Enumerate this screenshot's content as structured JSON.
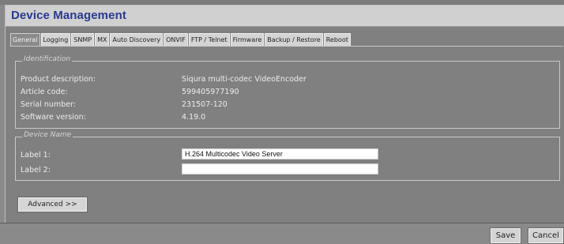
{
  "title": "Device Management",
  "tabs": [
    {
      "label": "General",
      "active": true
    },
    {
      "label": "Logging"
    },
    {
      "label": "SNMP"
    },
    {
      "label": "MX"
    },
    {
      "label": "Auto Discovery"
    },
    {
      "label": "ONVIF"
    },
    {
      "label": "FTP / Telnet"
    },
    {
      "label": "Firmware"
    },
    {
      "label": "Backup / Restore"
    },
    {
      "label": "Reboot"
    }
  ],
  "identification": {
    "legend": "Identification",
    "rows": [
      {
        "label": "Product description:",
        "value": "Siqura multi-codec VideoEncoder"
      },
      {
        "label": "Article code:",
        "value": "599405977190"
      },
      {
        "label": "Serial number:",
        "value": "231507-120"
      },
      {
        "label": "Software version:",
        "value": "4.19.0"
      }
    ]
  },
  "device_name": {
    "legend": "Device Name",
    "label1": {
      "label": "Label 1:",
      "value": "H.264 Multicodec Video Server"
    },
    "label2": {
      "label": "Label 2:",
      "value": ""
    }
  },
  "advanced_label": "Advanced >>",
  "footer": {
    "save_label": "Save",
    "cancel_label": "Cancel"
  }
}
